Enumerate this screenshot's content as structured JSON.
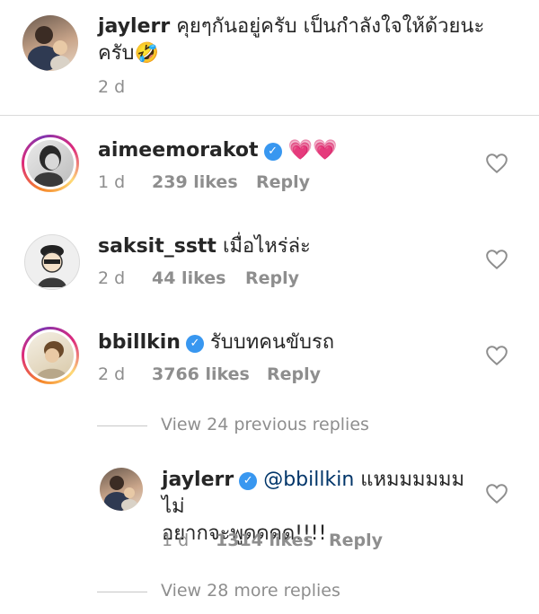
{
  "caption": {
    "username": "jaylerr",
    "text_line1": "คุยๆกันอยู่ครับ เป็นกำลังใจให้ด้วยนะ",
    "text_line2": "ครับ",
    "emoji": "🤣",
    "time": "2 d"
  },
  "comments": [
    {
      "username": "aimeemorakot",
      "verified": true,
      "text": "",
      "emoji": "💗💗",
      "time": "1 d",
      "likes": "239 likes",
      "reply": "Reply"
    },
    {
      "username": "saksit_sstt",
      "verified": false,
      "text": "เมื่อไหร่ล่ะ",
      "time": "2 d",
      "likes": "44 likes",
      "reply": "Reply"
    },
    {
      "username": "bbillkin",
      "verified": true,
      "text": "รับบทคนขับรถ",
      "time": "2 d",
      "likes": "3766 likes",
      "reply": "Reply"
    }
  ],
  "view_previous": "View 24 previous replies",
  "reply": {
    "username": "jaylerr",
    "verified": true,
    "mention": "@bbillkin",
    "text_line1": " แหมมมมมม ไม่",
    "text_line2": "อยากจะพูดดดด!!!!",
    "time": "1 d",
    "likes": "1314 likes",
    "reply": "Reply"
  },
  "view_more": "View 28 more replies",
  "icons": {
    "verified": "verified-badge-icon",
    "heart": "heart-outline-icon"
  },
  "colors": {
    "verified": "#3897f0",
    "meta": "#8e8e8e",
    "text": "#262626"
  }
}
